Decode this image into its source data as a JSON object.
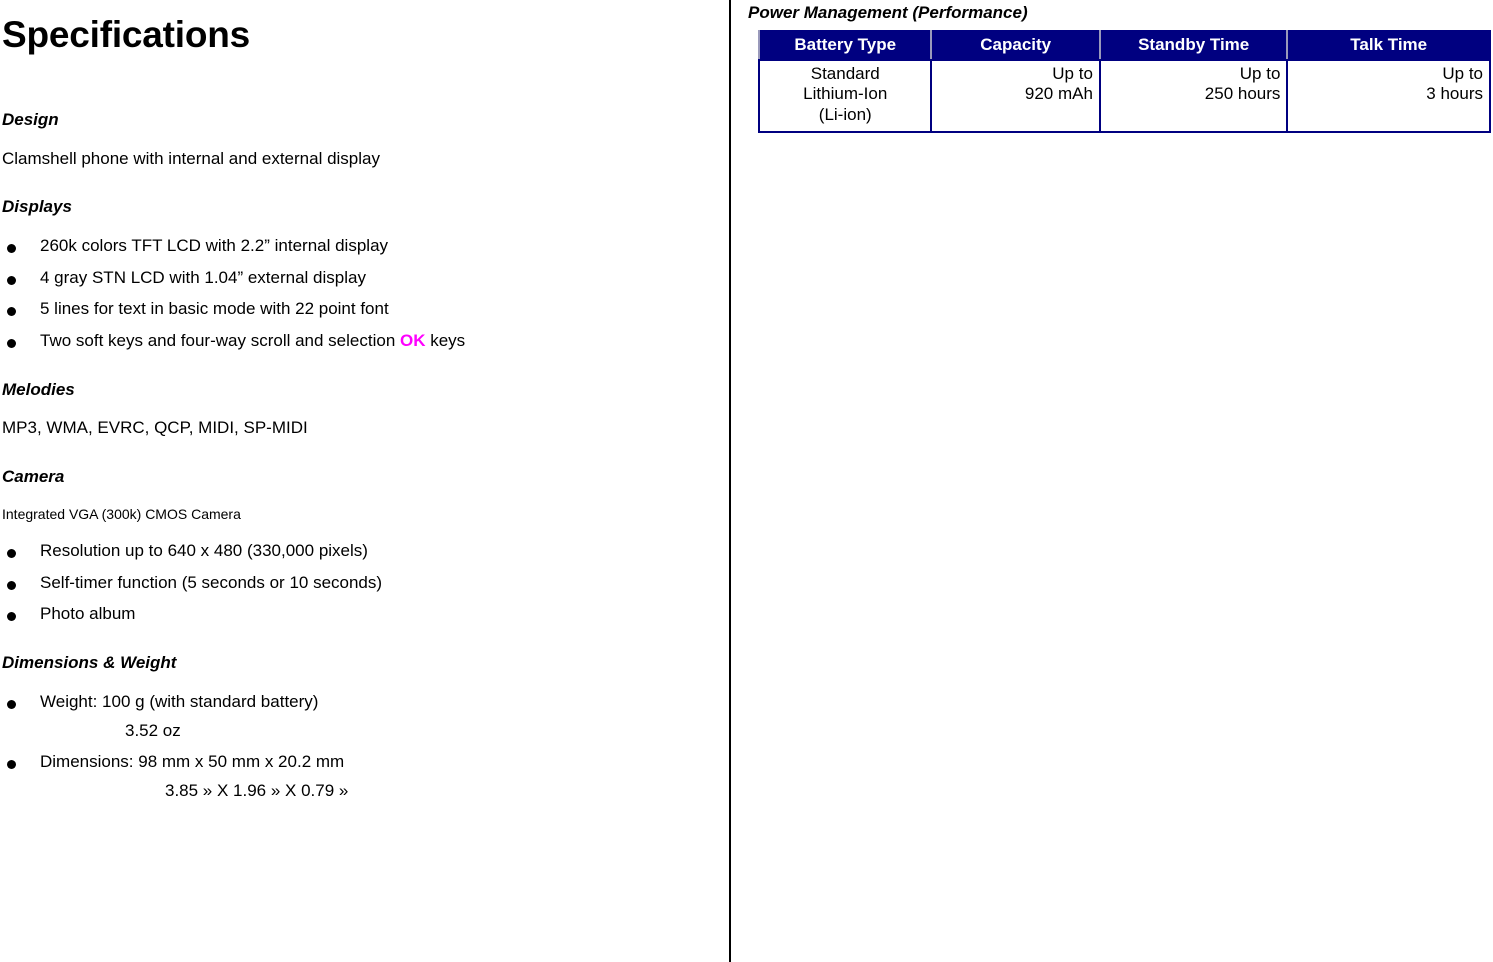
{
  "document": {
    "title": "Specifications"
  },
  "left_column": {
    "sections": [
      {
        "heading": "Design",
        "paragraph": "Clamshell phone with internal and external display"
      },
      {
        "heading": "Displays",
        "bullets": [
          "260k colors TFT LCD with 2.2” internal display",
          "4 gray STN LCD with 1.04” external display",
          "5 lines for text in basic mode with 22 point font"
        ],
        "bullet_ok": {
          "before": "Two soft keys and four-way scroll and selection ",
          "highlight": "OK",
          "after": " keys",
          "highlight_color": "#FF00FF"
        }
      },
      {
        "heading": "Melodies",
        "paragraph": "MP3, WMA, EVRC, QCP, MIDI, SP-MIDI"
      },
      {
        "heading": "Camera",
        "paragraph_small": "Integrated VGA (300k) CMOS Camera",
        "bullets": [
          "Resolution up to 640 x 480 (330,000 pixels)",
          "Self-timer function (5 seconds or 10 seconds)",
          "Photo album"
        ]
      },
      {
        "heading": "Dimensions & Weight",
        "weight_bullet": "Weight: 100 g (with standard battery)",
        "weight_imperial": "3.52 oz",
        "dimensions_bullet": "Dimensions: 98 mm x 50 mm x 20.2 mm",
        "dimensions_imperial": "3.85 » X  1.96 » X  0.79 »"
      }
    ]
  },
  "right_column": {
    "table_title": "Power Management (Performance)",
    "table": {
      "header_bg": "#000080",
      "header_text_color": "#FFFFFF",
      "border_color": "#000080",
      "columns": [
        "Battery Type",
        "Capacity",
        "Standby Time",
        "Talk Time"
      ],
      "rows": [
        {
          "battery_type_l1": "Standard",
          "battery_type_l2": "Lithium-Ion",
          "battery_type_l3": "(Li-ion)",
          "capacity_l1": "Up to",
          "capacity_l2": "920 mAh",
          "standby_l1": "Up to",
          "standby_l2": "250 hours",
          "talk_l1": "Up to",
          "talk_l2": "3 hours"
        }
      ]
    }
  }
}
